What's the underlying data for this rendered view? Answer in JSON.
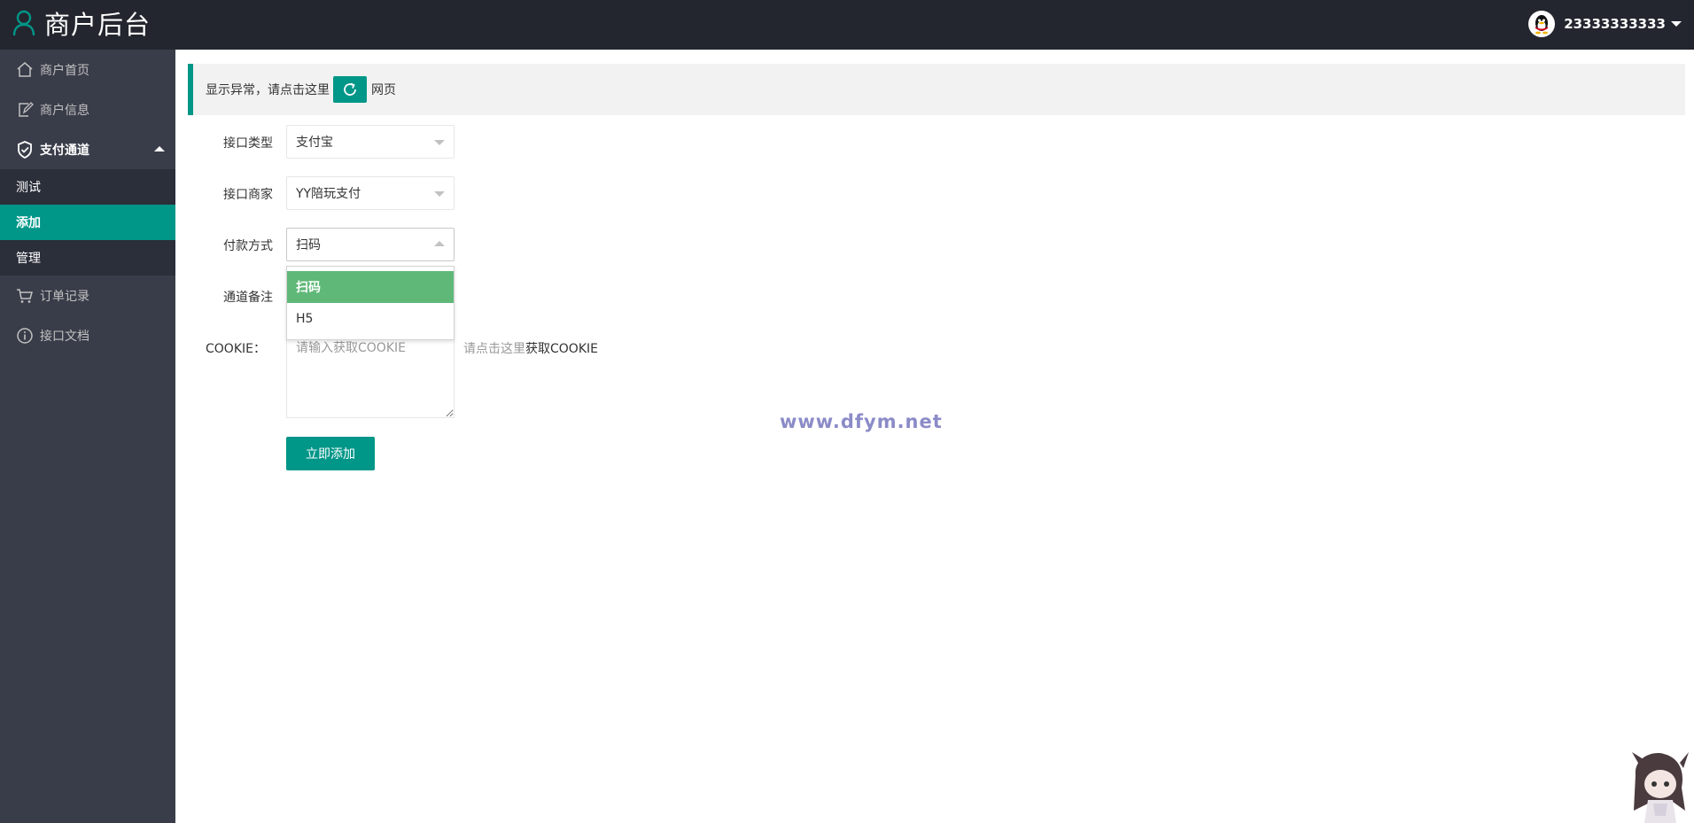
{
  "header": {
    "title": "商户后台",
    "username": "23333333333"
  },
  "sidebar": {
    "items": [
      {
        "label": "商户首页",
        "icon": "home-icon"
      },
      {
        "label": "商户信息",
        "icon": "edit-doc-icon"
      },
      {
        "label": "支付通道",
        "icon": "shield-icon",
        "expanded": true
      },
      {
        "label": "订单记录",
        "icon": "cart-icon"
      },
      {
        "label": "接口文档",
        "icon": "info-icon"
      }
    ],
    "subitems": [
      {
        "label": "测试",
        "active": false
      },
      {
        "label": "添加",
        "active": true
      },
      {
        "label": "管理",
        "active": false
      }
    ]
  },
  "notice": {
    "text_before": "显示异常，请点击这里",
    "text_after": "网页"
  },
  "form": {
    "interface_type": {
      "label": "接口类型",
      "value": "支付宝"
    },
    "interface_merchant": {
      "label": "接口商家",
      "value": "YY陪玩支付"
    },
    "payment_method": {
      "label": "付款方式",
      "value": "扫码",
      "options": [
        "扫码",
        "H5"
      ]
    },
    "channel_note": {
      "label": "通道备注"
    },
    "cookie": {
      "label": "COOKIE：",
      "placeholder": "请输入获取COOKIE",
      "tip_gray": "请点击这里",
      "tip_dark": "获取COOKIE"
    },
    "submit_label": "立即添加"
  },
  "watermark": "www.dfym.net",
  "colors": {
    "primary": "#009688",
    "header_bg": "#23262e",
    "sidebar_bg": "#393d49",
    "option_selected": "#5fb878"
  }
}
